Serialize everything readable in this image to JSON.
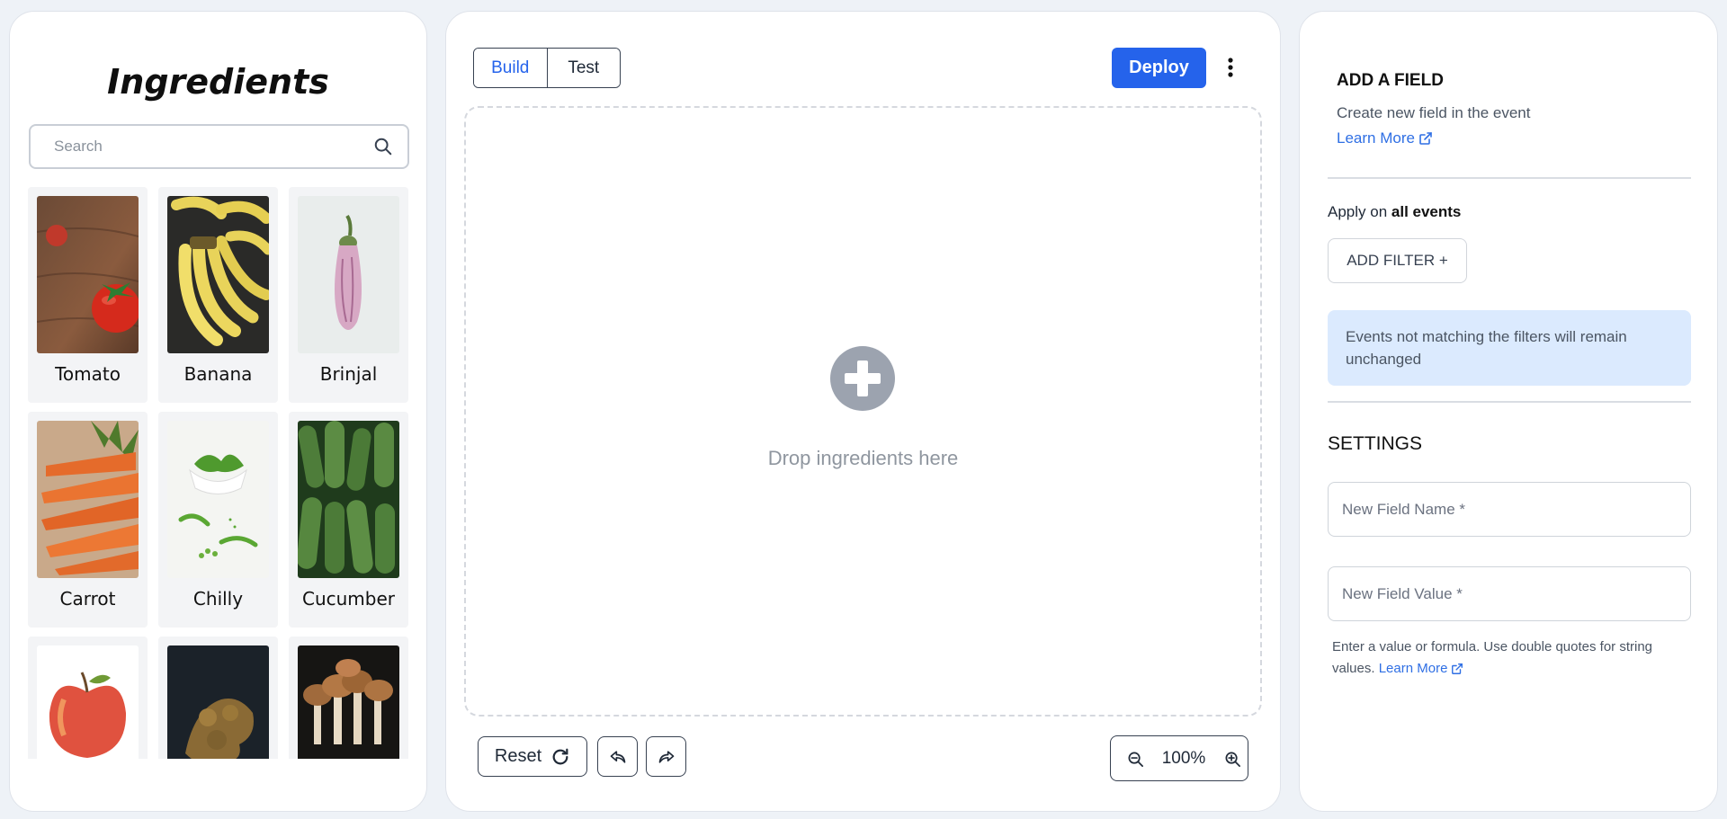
{
  "ingredients_panel": {
    "title": "Ingredients",
    "search": {
      "placeholder": "Search",
      "value": ""
    },
    "items": [
      {
        "name": "Tomato",
        "image": "tomato-image"
      },
      {
        "name": "Banana",
        "image": "banana-image"
      },
      {
        "name": "Brinjal",
        "image": "brinjal-image"
      },
      {
        "name": "Carrot",
        "image": "carrot-image"
      },
      {
        "name": "Chilly",
        "image": "chilly-image"
      },
      {
        "name": "Cucumber",
        "image": "cucumber-image"
      },
      {
        "name": "",
        "image": "apple-image"
      },
      {
        "name": "",
        "image": "ginger-image"
      },
      {
        "name": "",
        "image": "mushroom-image"
      }
    ]
  },
  "builder": {
    "tabs": [
      {
        "label": "Build",
        "active": true
      },
      {
        "label": "Test",
        "active": false
      }
    ],
    "deploy_label": "Deploy",
    "menu_icon": "kebab-icon",
    "drop_zone_text": "Drop ingredients here",
    "reset_label": "Reset",
    "undo_icon": "undo-icon",
    "redo_icon": "redo-icon",
    "zoom_level": "100%",
    "accent_color": "#2563eb"
  },
  "settings_panel": {
    "add_field_title": "ADD A FIELD",
    "add_field_description": "Create new field in the event",
    "learn_more_label": "Learn More",
    "apply_prefix": "Apply on ",
    "apply_target": "all events",
    "add_filter_label": "ADD FILTER +",
    "info_message": "Events not matching the filters will remain unchanged",
    "settings_title": "SETTINGS",
    "field_name_placeholder": "New Field Name *",
    "field_value_placeholder": "New Field Value *",
    "help_text": "Enter a value or formula. Use double quotes for string values.",
    "help_learn_more_label": "Learn More",
    "info_bg_color": "#dbeafe"
  }
}
